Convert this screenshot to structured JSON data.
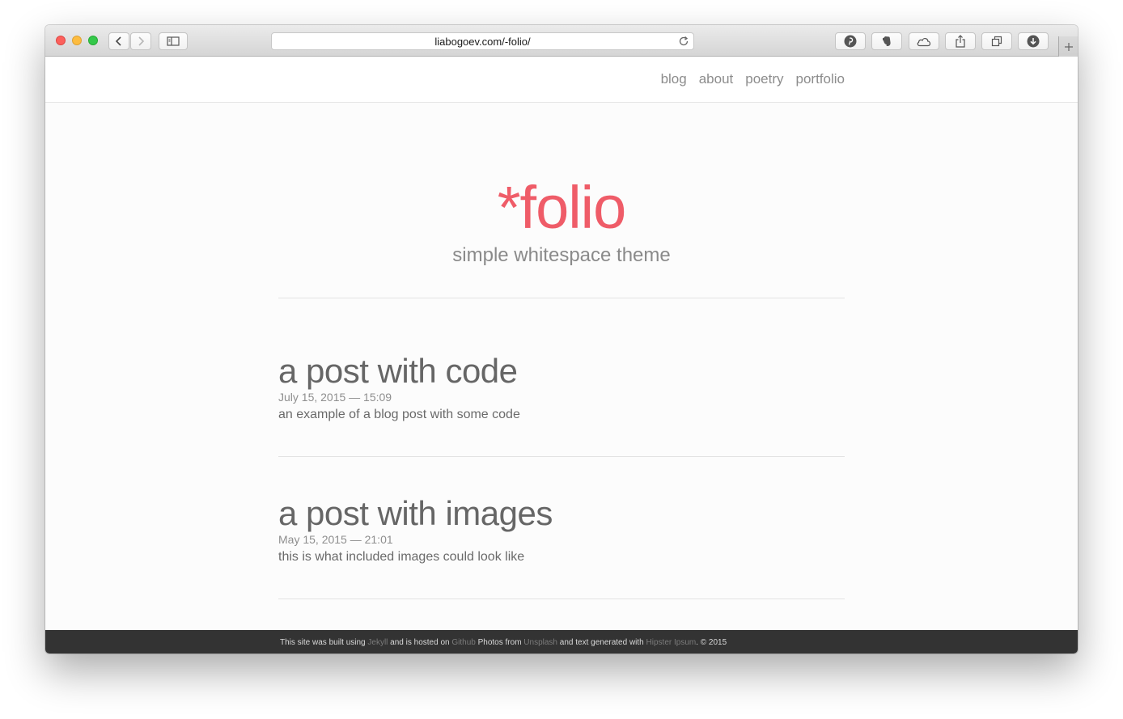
{
  "browser": {
    "url": "liabogoev.com/-folio/"
  },
  "nav": {
    "items": [
      {
        "label": "blog"
      },
      {
        "label": "about"
      },
      {
        "label": "poetry"
      },
      {
        "label": "portfolio"
      }
    ]
  },
  "hero": {
    "title": "*folio",
    "subtitle": "simple whitespace theme"
  },
  "posts": [
    {
      "title": "a post with code",
      "date": "July 15, 2015 — 15:09",
      "excerpt": "an example of a blog post with some code"
    },
    {
      "title": "a post with images",
      "date": "May 15, 2015 — 21:01",
      "excerpt": "this is what included images could look like"
    }
  ],
  "footer": {
    "t1": "This site was built using ",
    "l1": "Jekyll",
    "t2": " and is hosted on ",
    "l2": "Github",
    "t3": " Photos from ",
    "l3": "Unsplash",
    "t4": " and text generated with ",
    "l4": "Hipster Ipsum",
    "t5": ". © 2015"
  },
  "colors": {
    "accent": "#ef5c68",
    "footer_bg": "#333333",
    "text": "#666666"
  }
}
